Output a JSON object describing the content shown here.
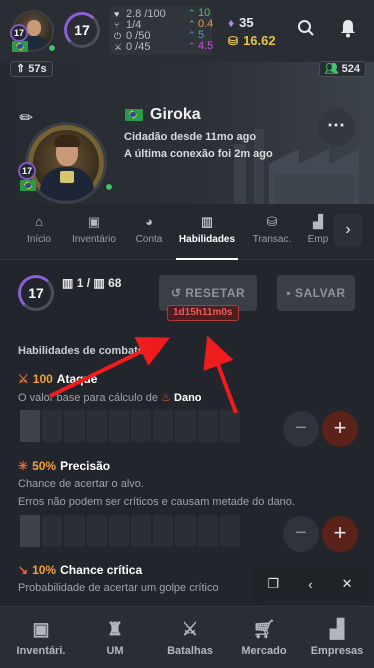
{
  "topbar": {
    "level": "17",
    "stats": [
      {
        "icon": "heart-icon",
        "value": "2.8 /100",
        "delta": "10",
        "delta_dir": "up",
        "delta_color": "#43c46b"
      },
      {
        "icon": "food-icon",
        "value": "1/4",
        "delta": "0.4",
        "delta_dir": "up",
        "delta_color": "#e89a3c"
      },
      {
        "icon": "energy-icon",
        "value": "0 /50",
        "delta": "5",
        "delta_dir": "up",
        "delta_color": "#4aa3e0"
      },
      {
        "icon": "fight-icon",
        "value": "0 /45",
        "delta": "4.5",
        "delta_dir": "up",
        "delta_color": "#c454d6"
      }
    ],
    "gems": "35",
    "gold": "16.62",
    "timer": "57s",
    "online_count": "524"
  },
  "profile": {
    "name": "Giroka",
    "citizen_since": "Cidadão desde 11mo ago",
    "last_connection": "A última conexão foi 2m ago",
    "level": "17"
  },
  "tabs": [
    {
      "label": "Início",
      "icon": "home-icon"
    },
    {
      "label": "Inventário",
      "icon": "bag-icon"
    },
    {
      "label": "Conta",
      "icon": "piggy-bank-icon"
    },
    {
      "label": "Habilidades",
      "icon": "book-icon",
      "active": true
    },
    {
      "label": "Transac.",
      "icon": "coins-icon"
    },
    {
      "label": "Emp",
      "icon": "factory-icon"
    }
  ],
  "skills": {
    "level": "17",
    "points_available": "1",
    "points_total": "68",
    "reset_label": "RESETAR",
    "save_label": "SALVAR",
    "reset_timer": "1d15h11m0s",
    "section_title": "Habilidades de combate",
    "items": [
      {
        "value": "100",
        "name": "Ataque",
        "desc_lines": [
          "O valor base para cálculo de"
        ],
        "desc_highlight": "Dano",
        "color": "#e56a3a",
        "filled": 1
      },
      {
        "value": "50%",
        "name": "Precisão",
        "desc_lines": [
          "Chance de acertar o alvo.",
          "Erros não podem ser críticos e causam metade do dano."
        ],
        "color": "#e56a3a",
        "filled": 1
      },
      {
        "value": "10%",
        "name": "Chance crítica",
        "desc_lines": [
          "Probabilidade de acertar um golpe crítico"
        ],
        "color": "#e56a3a",
        "filled": 0
      }
    ]
  },
  "bottom_nav": [
    {
      "label": "Inventári.",
      "icon": "backpack-icon"
    },
    {
      "label": "UM",
      "icon": "tower-icon"
    },
    {
      "label": "Batalhas",
      "icon": "swords-icon"
    },
    {
      "label": "Mercado",
      "icon": "cart-icon"
    },
    {
      "label": "Empresas",
      "icon": "factory-icon"
    }
  ]
}
